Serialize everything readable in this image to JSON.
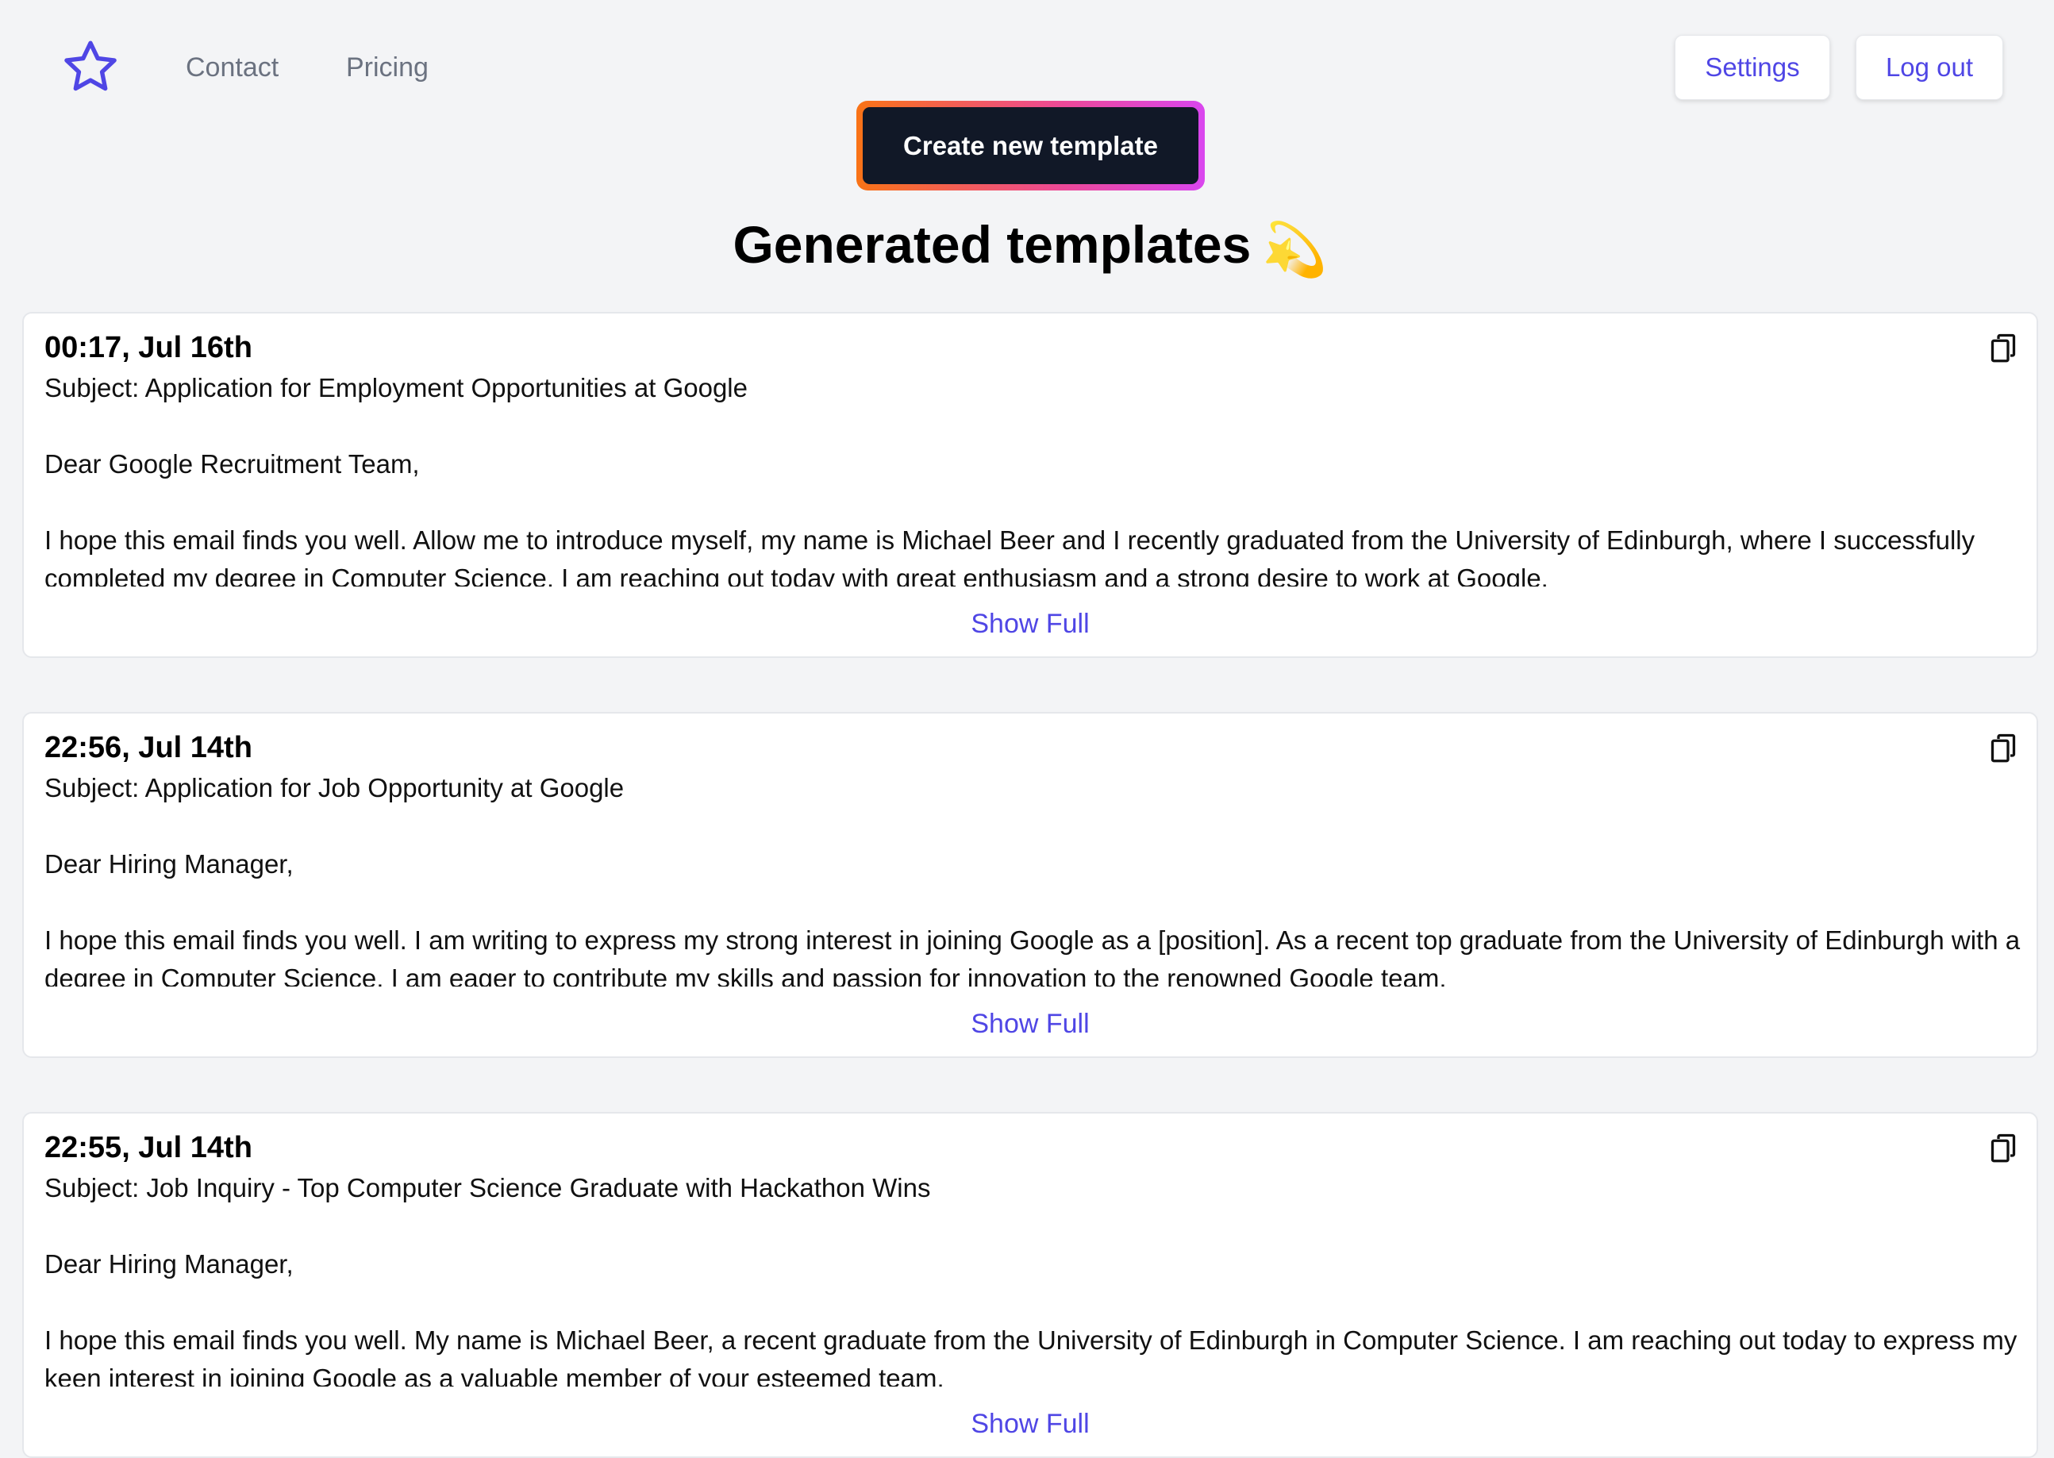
{
  "nav": {
    "logo_icon": "star-outline-icon",
    "contact": "Contact",
    "pricing": "Pricing"
  },
  "header": {
    "settings": "Settings",
    "logout": "Log out"
  },
  "create_button": "Create new template",
  "page": {
    "title": "Generated templates",
    "title_emoji": "💫"
  },
  "colors": {
    "accent": "#4f46e5",
    "create_bg": "#111827",
    "page_bg": "#f3f4f6"
  },
  "templates": [
    {
      "time": "00:17, Jul 16th",
      "subject": "Subject: Application for Employment Opportunities at Google",
      "greeting": "Dear Google Recruitment Team,",
      "body": "I hope this email finds you well. Allow me to introduce myself, my name is Michael Beer and I recently graduated from the University of Edinburgh, where I successfully completed my degree in Computer Science. I am reaching out today with great enthusiasm and a strong desire to work at Google.",
      "show_full": "Show Full",
      "copy_icon": "copy-icon"
    },
    {
      "time": "22:56, Jul 14th",
      "subject": "Subject: Application for Job Opportunity at Google",
      "greeting": "Dear Hiring Manager,",
      "body": "I hope this email finds you well. I am writing to express my strong interest in joining Google as a [position]. As a recent top graduate from the University of Edinburgh with a degree in Computer Science, I am eager to contribute my skills and passion for innovation to the renowned Google team.",
      "show_full": "Show Full",
      "copy_icon": "copy-icon"
    },
    {
      "time": "22:55, Jul 14th",
      "subject": "Subject: Job Inquiry - Top Computer Science Graduate with Hackathon Wins",
      "greeting": "Dear Hiring Manager,",
      "body": "I hope this email finds you well. My name is Michael Beer, a recent graduate from the University of Edinburgh in Computer Science. I am reaching out today to express my keen interest in joining Google as a valuable member of your esteemed team.",
      "show_full": "Show Full",
      "copy_icon": "copy-icon"
    }
  ]
}
